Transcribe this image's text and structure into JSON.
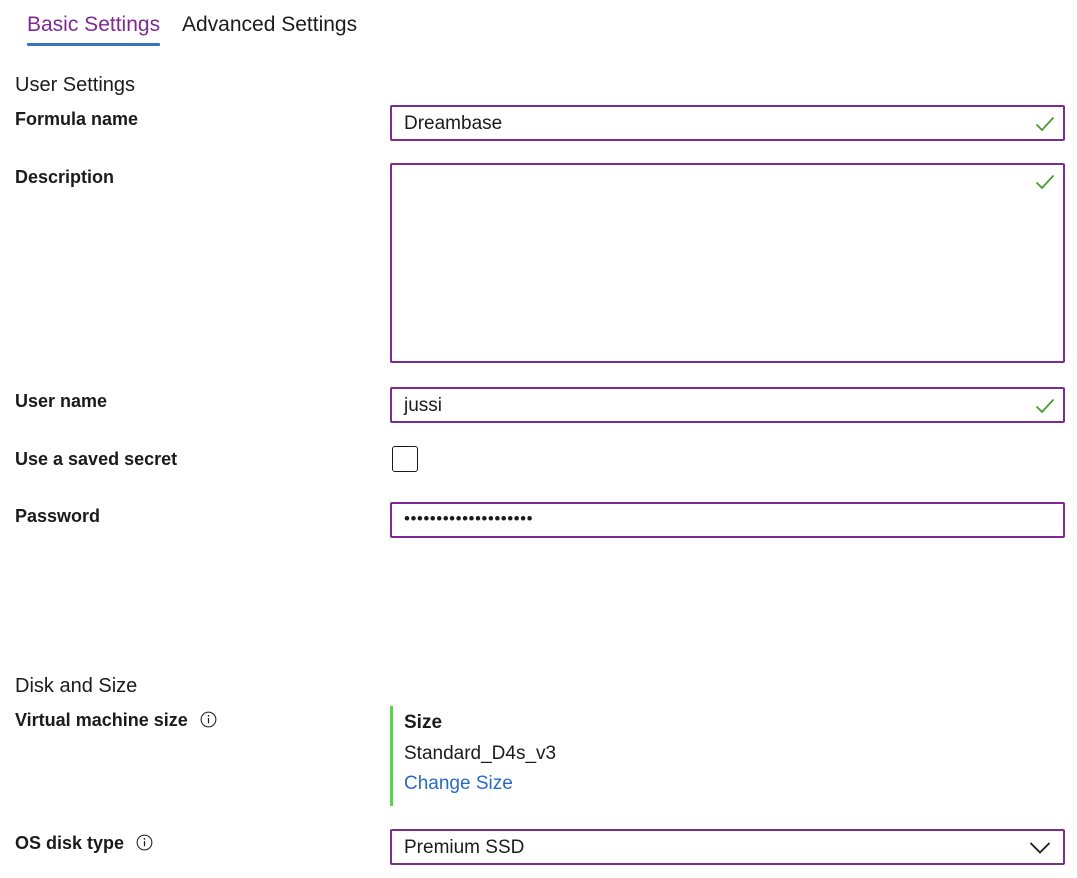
{
  "tabs": [
    {
      "label": "Basic Settings",
      "active": true
    },
    {
      "label": "Advanced Settings",
      "active": false
    }
  ],
  "user_settings": {
    "heading": "User Settings",
    "formula_name": {
      "label": "Formula name",
      "value": "Dreambase",
      "valid": true
    },
    "description": {
      "label": "Description",
      "value": "",
      "valid": true
    },
    "user_name": {
      "label": "User name",
      "value": "jussi",
      "valid": true
    },
    "saved_secret": {
      "label": "Use a saved secret",
      "checked": false
    },
    "password": {
      "label": "Password",
      "value": "••••••••••••••••••••"
    }
  },
  "disk_and_size": {
    "heading": "Disk and Size",
    "vm_size": {
      "label": "Virtual machine size",
      "size_title": "Size",
      "size_value": "Standard_D4s_v3",
      "change_link": "Change Size"
    },
    "os_disk_type": {
      "label": "OS disk type",
      "value": "Premium SSD"
    }
  },
  "colors": {
    "accent_purple": "#7d2a93",
    "tab_underline": "#3b6fc4",
    "valid_green": "#4a9a2e",
    "size_bar_green": "#57d44a",
    "link_blue": "#2a6bc2"
  },
  "icons": {
    "valid": "checkmark-icon",
    "info": "info-icon",
    "dropdown": "chevron-down-icon"
  }
}
